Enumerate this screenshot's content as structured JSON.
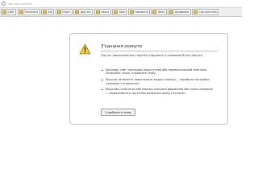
{
  "address_bar": {
    "url": "mac.org.ua/uptime"
  },
  "bookmarks": [
    {
      "label": "Сайт"
    },
    {
      "label": "Технолоґії"
    },
    {
      "label": "Біо"
    },
    {
      "label": "Спорт"
    },
    {
      "label": "Щоу Біз"
    },
    {
      "label": "Наука"
    },
    {
      "label": "Todo"
    },
    {
      "label": "Навчання"
    },
    {
      "label": "Фото"
    },
    {
      "label": "Цікавинки"
    },
    {
      "label": "Соц.політика"
    }
  ],
  "error": {
    "title": "З'єднання скинуто",
    "description": "Під час завантаження сторінки з'єднання із сервером було скинуто.",
    "bullets": [
      [
        "Можливо, сайт тимчасово недоступний або перевантажений запитами.",
        "Почекайте трохи і спробуйте знову."
      ],
      [
        "Якщо ви не можете завантажити жодну сторінку — перевірте настройки",
        "з'єднання з Інтернетом."
      ],
      [
        "Якщо ваш комп'ютер або мережа захищені фаєрволом або проксі-сервером",
        "— переконайтеся, що Firefox дозволено вихід в Інтернет."
      ]
    ],
    "retry_label": "Спробувати знову"
  },
  "colors": {
    "warning_yellow": "#f2cd2e",
    "warning_border": "#8a7b22",
    "folder_yellow": "#e9c35a"
  }
}
